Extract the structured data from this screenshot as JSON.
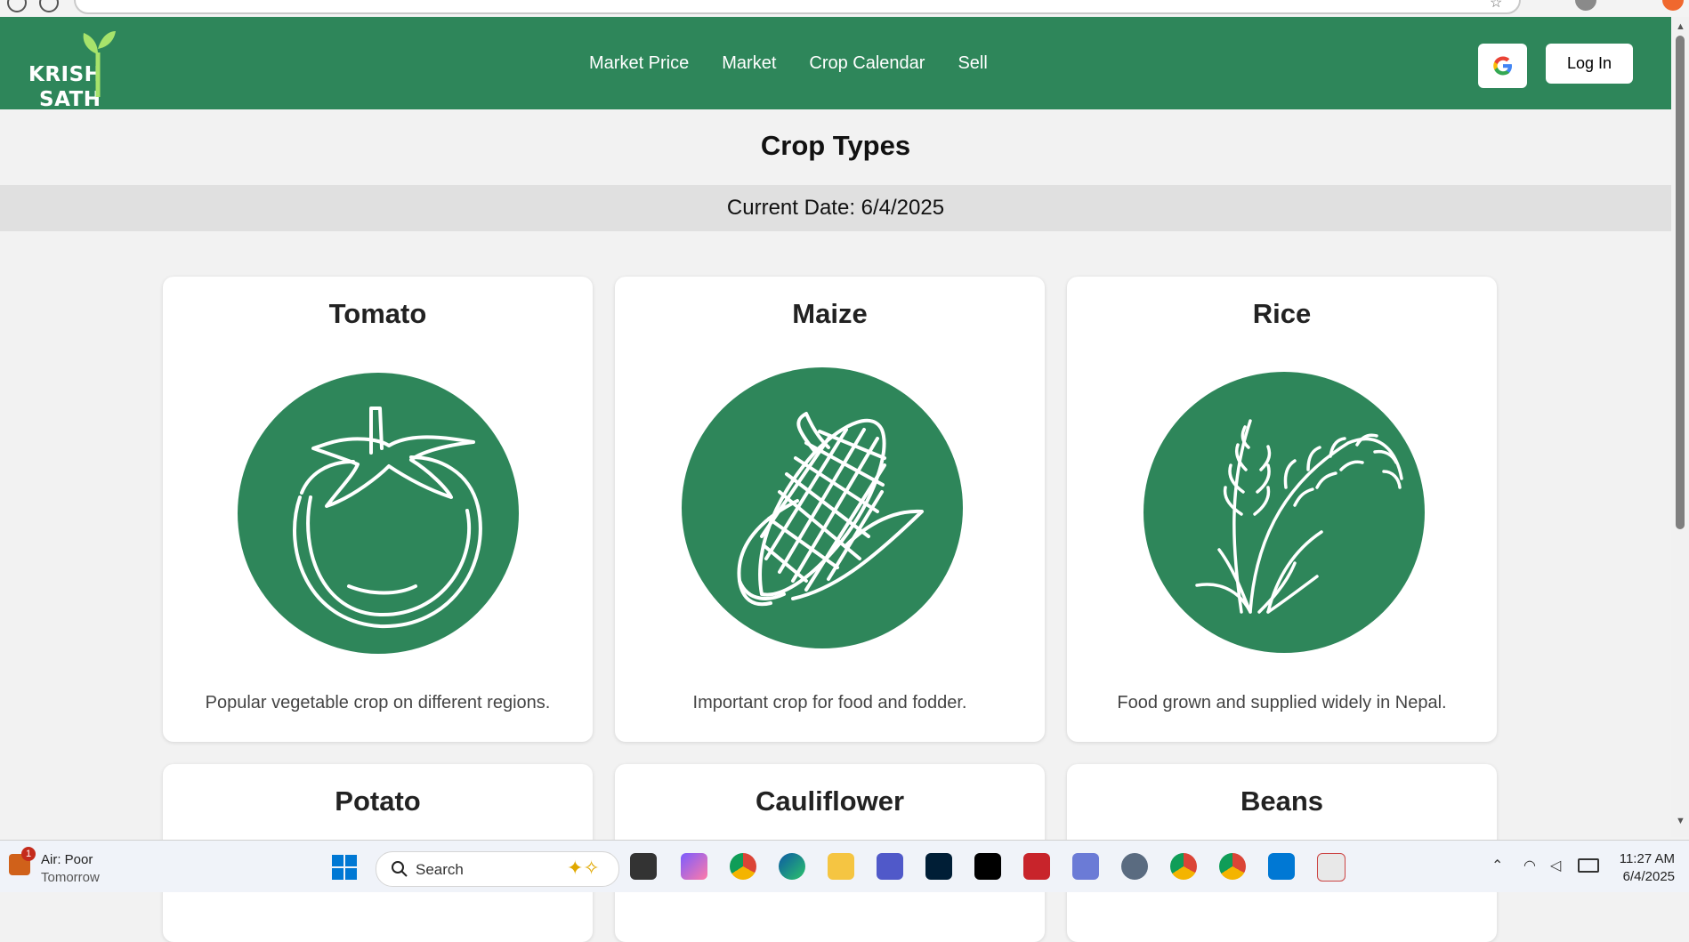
{
  "app": {
    "logo_line1": "KRISH",
    "logo_line2": "SATH",
    "brand_color": "#2e865a"
  },
  "nav": {
    "links": [
      "Market Price",
      "Market",
      "Crop Calendar",
      "Sell"
    ],
    "google_icon": "google-icon",
    "login_label": "Log In"
  },
  "page": {
    "title": "Crop Types",
    "current_date": "Current Date: 6/4/2025"
  },
  "crops": [
    {
      "name": "Tomato",
      "description": "Popular vegetable crop on different regions.",
      "icon": "tomato-icon"
    },
    {
      "name": "Maize",
      "description": "Important crop for food and fodder.",
      "icon": "corn-icon"
    },
    {
      "name": "Rice",
      "description": "Food grown and supplied widely in Nepal.",
      "icon": "rice-icon"
    },
    {
      "name": "Potato",
      "description": "",
      "icon": ""
    },
    {
      "name": "Cauliflower",
      "description": "",
      "icon": ""
    },
    {
      "name": "Beans",
      "description": "",
      "icon": ""
    }
  ],
  "taskbar": {
    "weather_title": "Air: Poor",
    "weather_sub": "Tomorrow",
    "weather_badge": "1",
    "search_placeholder": "Search",
    "time": "11:27 AM",
    "date": "6/4/2025"
  }
}
